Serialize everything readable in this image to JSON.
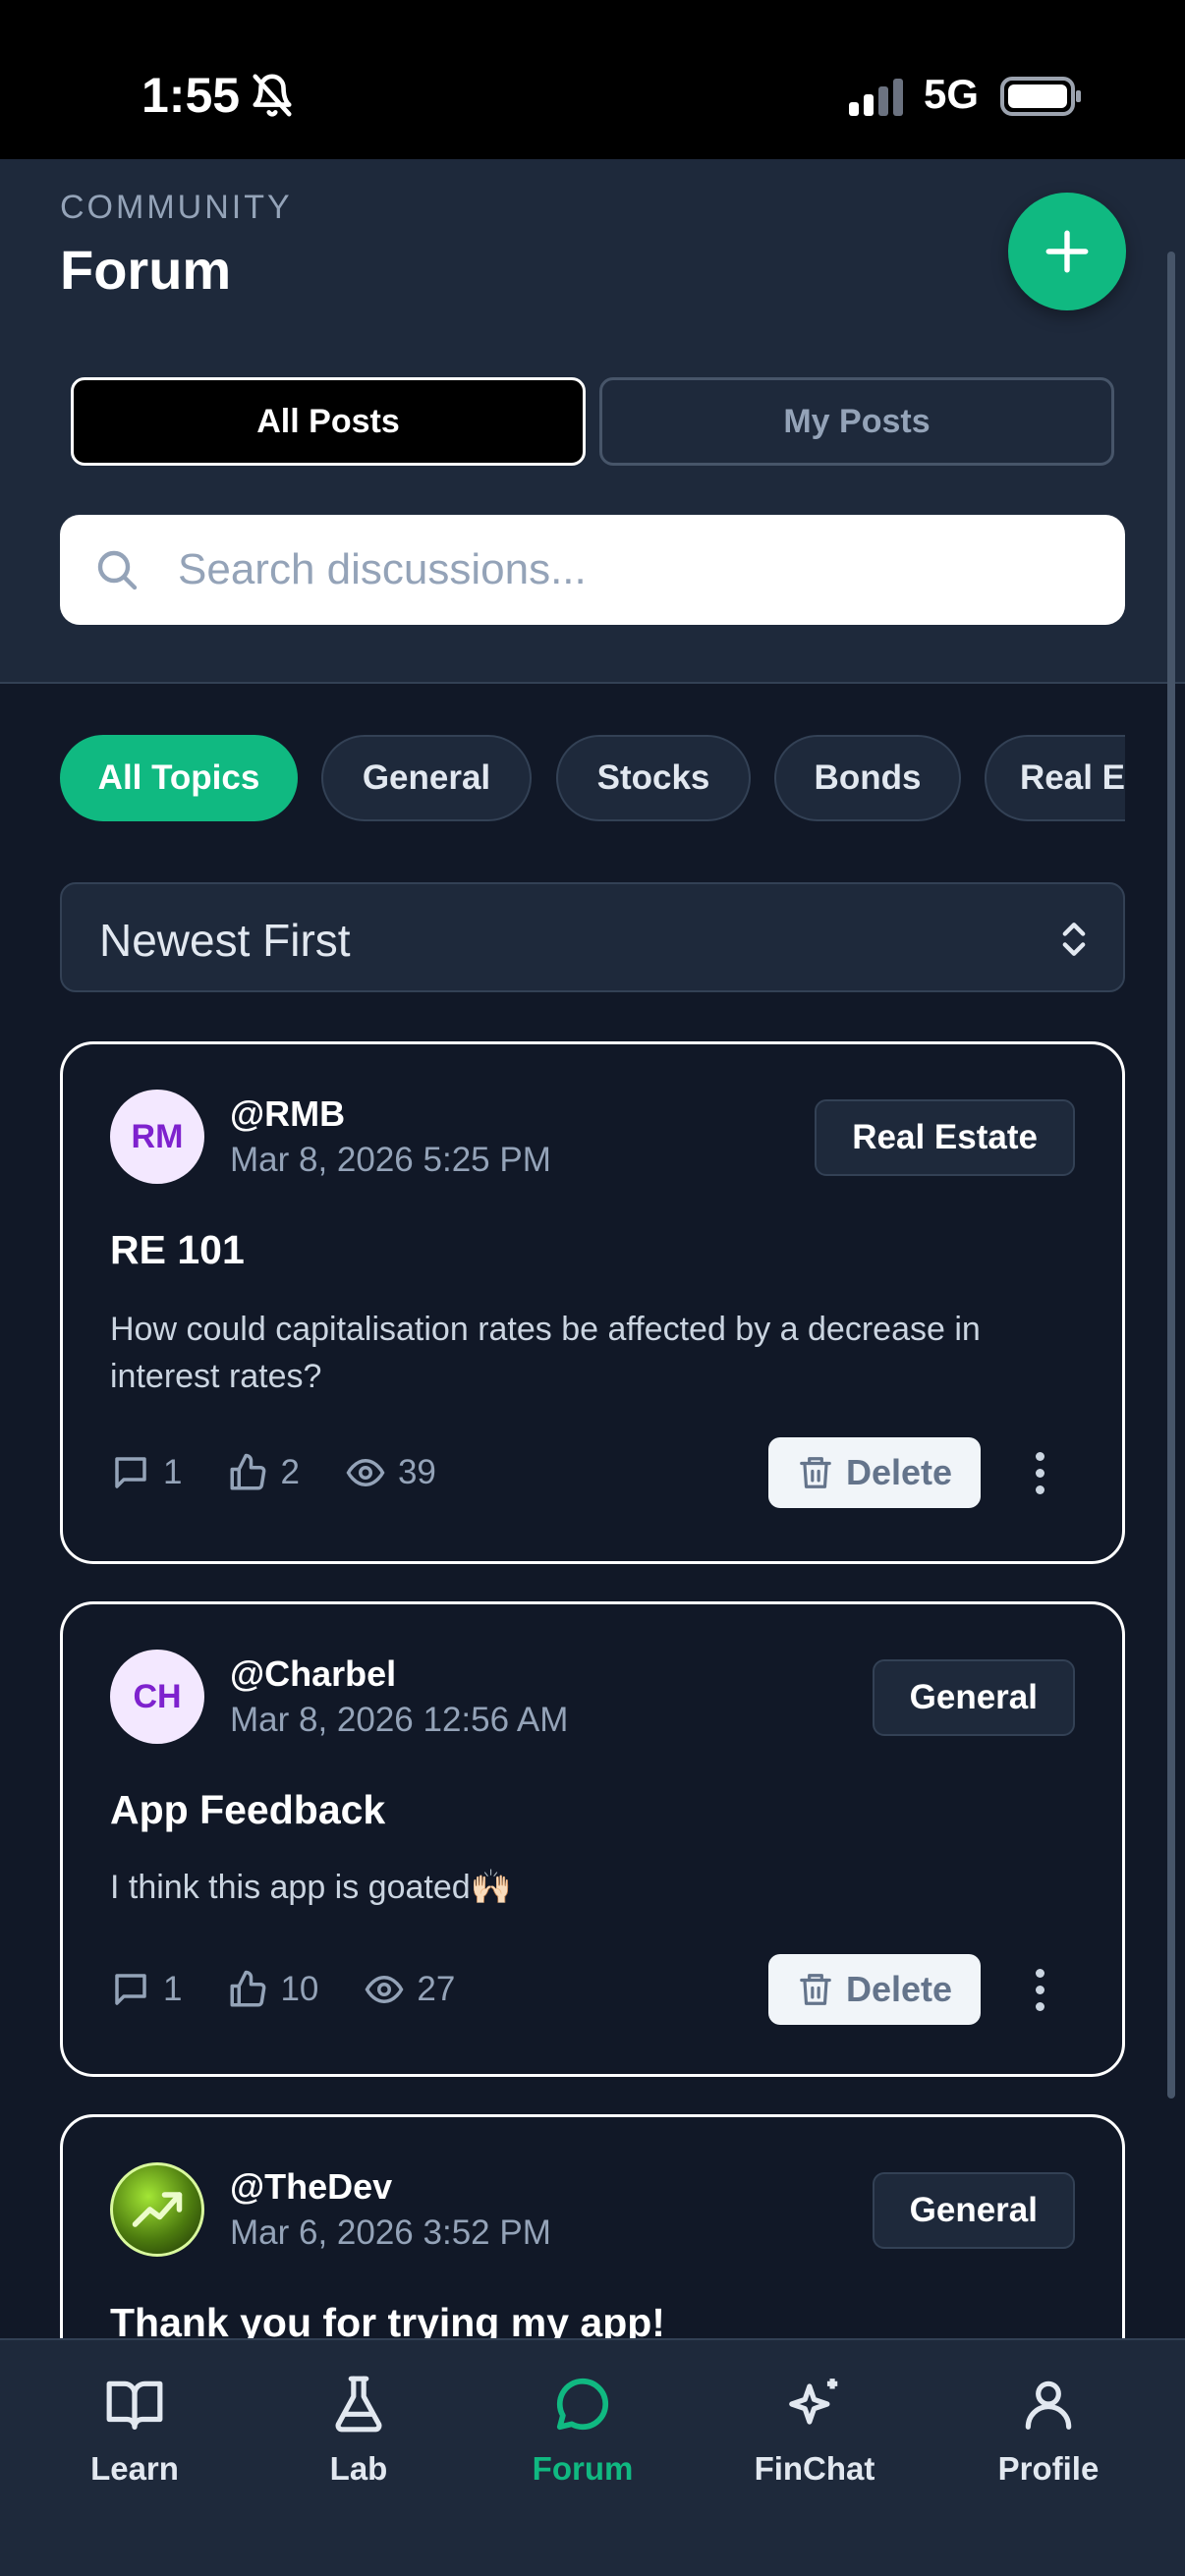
{
  "status_bar": {
    "time": "1:55",
    "network": "5G"
  },
  "header": {
    "kicker": "COMMUNITY",
    "title": "Forum",
    "tabs": [
      {
        "label": "All Posts",
        "active": true
      },
      {
        "label": "My Posts",
        "active": false
      }
    ]
  },
  "search": {
    "placeholder": "Search discussions...",
    "value": ""
  },
  "topics": [
    {
      "label": "All Topics",
      "active": true
    },
    {
      "label": "General",
      "active": false
    },
    {
      "label": "Stocks",
      "active": false
    },
    {
      "label": "Bonds",
      "active": false
    },
    {
      "label": "Real Estate",
      "active": false
    }
  ],
  "sort": {
    "selected": "Newest First"
  },
  "posts": [
    {
      "initials": "RM",
      "username": "@RMB",
      "timestamp": "Mar 8, 2026 5:25 PM",
      "topic": "Real Estate",
      "title": "RE 101",
      "body": "How could capitalisation rates be affected by a decrease in interest rates?",
      "comments": "1",
      "likes": "2",
      "views": "39",
      "delete_label": "Delete"
    },
    {
      "initials": "CH",
      "username": "@Charbel",
      "timestamp": "Mar 8, 2026 12:56 AM",
      "topic": "General",
      "title": "App Feedback",
      "body": "I think this app is goated🙌🏻",
      "comments": "1",
      "likes": "10",
      "views": "27",
      "delete_label": "Delete"
    },
    {
      "initials": "",
      "username": "@TheDev",
      "timestamp": "Mar 6, 2026 3:52 PM",
      "topic": "General",
      "title": "Thank you for trying my app!"
    }
  ],
  "nav": [
    {
      "label": "Learn",
      "icon": "book-icon"
    },
    {
      "label": "Lab",
      "icon": "flask-icon"
    },
    {
      "label": "Forum",
      "icon": "chat-bubble-icon",
      "active": true
    },
    {
      "label": "FinChat",
      "icon": "sparkles-icon"
    },
    {
      "label": "Profile",
      "icon": "user-icon"
    }
  ],
  "colors": {
    "accent": "#10b981",
    "background": "#111827",
    "surface": "#1e293b"
  }
}
